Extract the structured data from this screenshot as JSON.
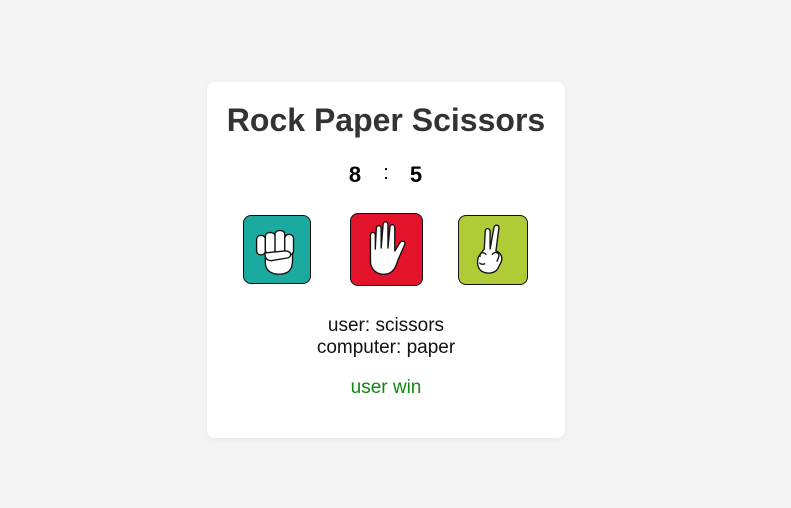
{
  "game": {
    "title": "Rock Paper Scissors",
    "score": {
      "user": "8",
      "separator": ":",
      "computer": "5"
    },
    "choices": [
      {
        "id": "rock",
        "color": "#1aaa9f",
        "icon": "fist-icon"
      },
      {
        "id": "paper",
        "color": "#e3132b",
        "icon": "open-hand-icon"
      },
      {
        "id": "scissors",
        "color": "#afcb35",
        "icon": "peace-hand-icon"
      }
    ],
    "status": {
      "user_line": "user: scissors",
      "computer_line": "computer: paper",
      "result": "user win",
      "result_color": "#118811"
    }
  }
}
